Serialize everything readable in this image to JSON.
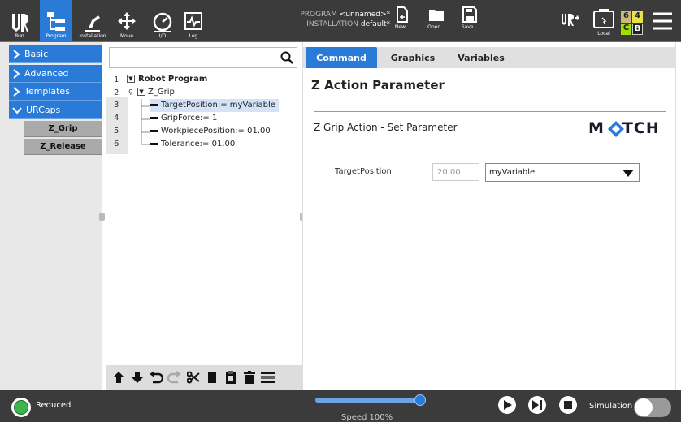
{
  "header": {
    "run": "Run",
    "program": "Program",
    "installation": "Installation",
    "move": "Move",
    "io": "I/O",
    "log": "Log",
    "program_label": "PROGRAM",
    "program_value": "<unnamed>*",
    "installation_label": "INSTALLATION",
    "installation_value": "default*",
    "new": "New...",
    "open": "Open...",
    "save": "Save...",
    "local": "Local",
    "badge_6": "6",
    "badge_4": "4",
    "badge_c": "C",
    "badge_b": "B"
  },
  "sidebar": {
    "basic": "Basic",
    "advanced": "Advanced",
    "templates": "Templates",
    "urcaps": "URCaps",
    "items": [
      "Z_Grip",
      "Z_Release"
    ]
  },
  "tree": {
    "lines": [
      {
        "n": "1",
        "text": "Robot Program"
      },
      {
        "n": "2",
        "text": "Z_Grip"
      },
      {
        "n": "3",
        "text": "TargetPosition:= myVariable"
      },
      {
        "n": "4",
        "text": "GripForce:= 1"
      },
      {
        "n": "5",
        "text": "WorkpiecePosition:= 01.00"
      },
      {
        "n": "6",
        "text": "Tolerance:= 01.00"
      }
    ]
  },
  "tabs": {
    "command": "Command",
    "graphics": "Graphics",
    "variables": "Variables"
  },
  "panel": {
    "title": "Z Action Parameter",
    "section": "Z Grip Action - Set Parameter",
    "logo": "MATCH",
    "field_label": "TargetPosition",
    "field_value": "20.00",
    "dropdown_value": "myVariable"
  },
  "footer": {
    "status": "Reduced",
    "speed": "Speed 100%",
    "speed_fraction": 1.0,
    "simulation": "Simulation"
  },
  "colors": {
    "accent": "#2a7ad8",
    "bar": "#3b3b3b",
    "status_green": "#3cb64a"
  }
}
